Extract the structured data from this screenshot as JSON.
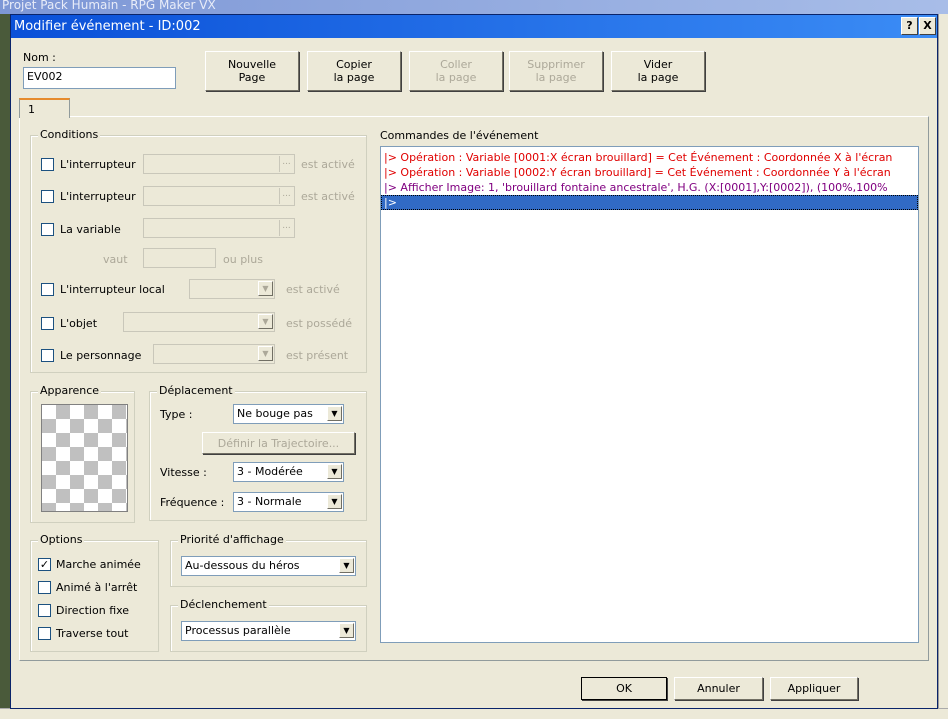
{
  "background": {
    "app_title": "Projet Pack Humain - RPG Maker VX"
  },
  "dialog": {
    "title": "Modifier événement - ID:002",
    "help": "?",
    "close": "X"
  },
  "name": {
    "label": "Nom :",
    "value": "EV002"
  },
  "toolbar": {
    "new_page": [
      "Nouvelle",
      "Page"
    ],
    "copy_page": [
      "Copier",
      "la page"
    ],
    "paste_page": [
      "Coller",
      "la page"
    ],
    "delete_page": [
      "Supprimer",
      "la page"
    ],
    "clear_page": [
      "Vider",
      "la page"
    ]
  },
  "tabs": [
    "1"
  ],
  "conditions": {
    "title": "Conditions",
    "switch1": {
      "label": "L'interrupteur",
      "suffix": "est activé",
      "checked": false
    },
    "switch2": {
      "label": "L'interrupteur",
      "suffix": "est activé",
      "checked": false
    },
    "variable": {
      "label": "La variable",
      "checked": false,
      "vaut": "vaut",
      "ou_plus": "ou plus"
    },
    "self_switch": {
      "label": "L'interrupteur local",
      "suffix": "est activé",
      "checked": false
    },
    "item": {
      "label": "L'objet",
      "suffix": "est possédé",
      "checked": false
    },
    "actor": {
      "label": "Le personnage",
      "suffix": "est présent",
      "checked": false
    }
  },
  "appearance": {
    "title": "Apparence"
  },
  "movement": {
    "title": "Déplacement",
    "type_label": "Type :",
    "type_value": "Ne bouge pas",
    "route_button": "Définir la Trajectoire...",
    "speed_label": "Vitesse :",
    "speed_value": "3 - Modérée",
    "freq_label": "Fréquence :",
    "freq_value": "3 - Normale"
  },
  "options": {
    "title": "Options",
    "items": [
      {
        "label": "Marche animée",
        "checked": true
      },
      {
        "label": "Animé à l'arrêt",
        "checked": false
      },
      {
        "label": "Direction fixe",
        "checked": false
      },
      {
        "label": "Traverse tout",
        "checked": false
      }
    ]
  },
  "priority": {
    "title": "Priorité d'affichage",
    "value": "Au-dessous du héros"
  },
  "trigger": {
    "title": "Déclenchement",
    "value": "Processus parallèle"
  },
  "commands": {
    "title": "Commandes de l'événement",
    "rows": [
      {
        "text": "|> Opération : Variable [0001:X écran brouillard] = Cet Événement : Coordonnée X à l'écran",
        "color": "#e00000"
      },
      {
        "text": "|> Opération : Variable [0002:Y écran brouillard] = Cet Événement : Coordonnée Y à l'écran",
        "color": "#e00000"
      },
      {
        "text": "|> Afficher Image: 1, 'brouillard fontaine ancestrale', H.G. (X:[0001],Y:[0002]), (100%,100%",
        "color": "#800080"
      },
      {
        "text": "|>",
        "color": "#ffffff",
        "selected": true
      }
    ]
  },
  "footer": {
    "ok": "OK",
    "cancel": "Annuler",
    "apply": "Appliquer"
  },
  "colors": {
    "title_bar": "#0a50d8",
    "selection": "#316ac5",
    "dialog_bg": "#ece9d8"
  }
}
